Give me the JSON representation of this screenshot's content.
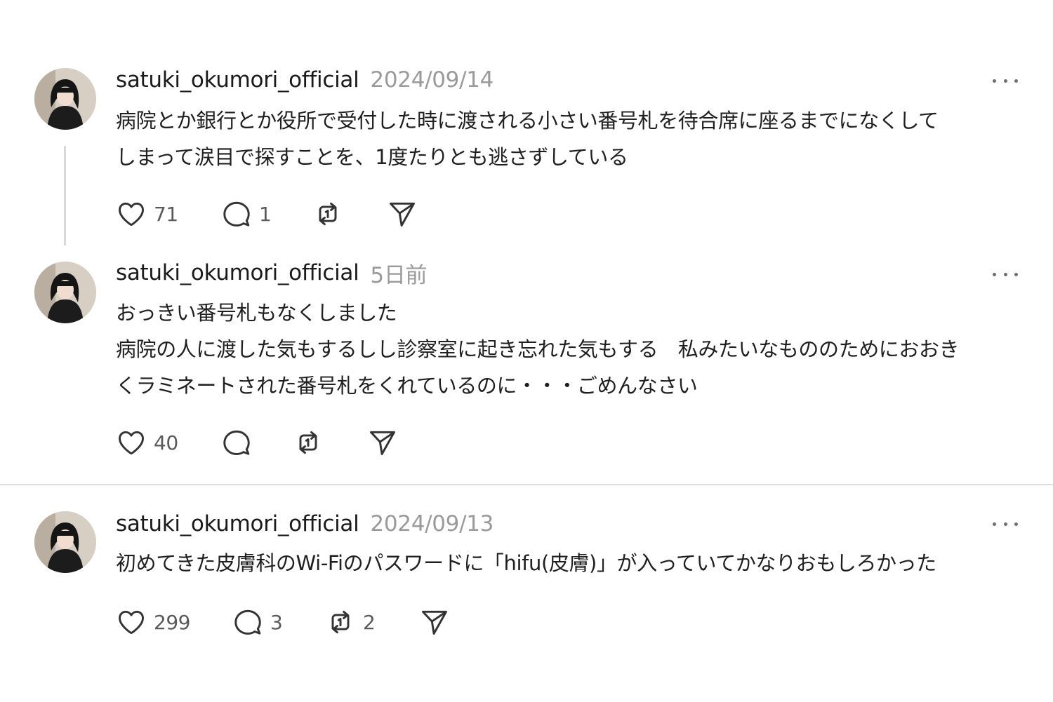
{
  "posts": [
    {
      "username": "satuki_okumori_official",
      "timestamp": "2024/09/14",
      "lines": [
        "病院とか銀行とか役所で受付した時に渡される小さい番号札を待合席に座るまでになくして",
        "しまって涙目で探すことを、1度たりとも逃さずしている"
      ],
      "likes": "71",
      "replies": "1",
      "reposts": "",
      "shares": ""
    },
    {
      "username": "satuki_okumori_official",
      "timestamp": "5日前",
      "lines": [
        "おっきい番号札もなくしました",
        "病院の人に渡した気もするしし診察室に起き忘れた気もする　私みたいなもののためにおおき",
        "くラミネートされた番号札をくれているのに・・・ごめんなさい"
      ],
      "likes": "40",
      "replies": "",
      "reposts": "",
      "shares": ""
    },
    {
      "username": "satuki_okumori_official",
      "timestamp": "2024/09/13",
      "lines": [
        "初めてきた皮膚科のWi-Fiのパスワードに「hifu(皮膚)」が入っていてかなりおもしろかった"
      ],
      "likes": "299",
      "replies": "3",
      "reposts": "2",
      "shares": ""
    }
  ],
  "icons": {
    "like": "heart-icon",
    "reply": "comment-icon",
    "repost": "repost-icon",
    "share": "send-icon",
    "more": "more-horizontal-icon"
  },
  "colors": {
    "text": "#1a1a1a",
    "muted": "#9a9a9a",
    "divider": "#dedede",
    "thread_line": "#d9d9d9"
  }
}
